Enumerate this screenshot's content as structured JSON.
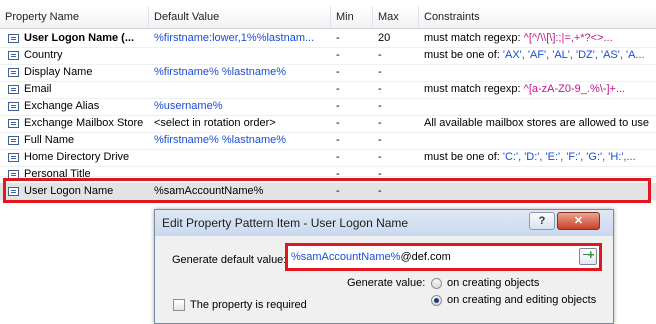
{
  "table": {
    "columns": [
      "Property Name",
      "Default Value",
      "Min",
      "Max",
      "Constraints"
    ],
    "rows": [
      {
        "name": "User Logon Name (...",
        "bold": true,
        "default": "%firstname:lower,1%%lastnam...",
        "min": "-",
        "max": "20",
        "constraints_prefix": "must match regexp: ",
        "constraints_value": "^[^/\\\\[\\]:;|=,+*?<>...",
        "value_blue": true
      },
      {
        "name": "Country",
        "bold": false,
        "default": "",
        "min": "-",
        "max": "-",
        "constraints_prefix": "must be one of: ",
        "constraints_value": "'AX', 'AF', 'AL', 'DZ', 'AS', 'A...",
        "value_blue": true
      },
      {
        "name": "Display Name",
        "bold": false,
        "default": "%firstname% %lastname%",
        "min": "-",
        "max": "-",
        "constraints_prefix": "",
        "constraints_value": "",
        "value_blue": true
      },
      {
        "name": "Email",
        "bold": false,
        "default": "",
        "min": "-",
        "max": "-",
        "constraints_prefix": "must match regexp: ",
        "constraints_value": "^[a-zA-Z0-9_.%\\-]+...",
        "value_blue": true
      },
      {
        "name": "Exchange Alias",
        "bold": false,
        "default": "%username%",
        "min": "-",
        "max": "-",
        "constraints_prefix": "",
        "constraints_value": "",
        "value_blue": true
      },
      {
        "name": "Exchange Mailbox Store",
        "bold": false,
        "default": "<select in rotation order>",
        "min": "-",
        "max": "-",
        "constraints_prefix": "All available mailbox stores are allowed to use",
        "constraints_value": "",
        "value_blue": false
      },
      {
        "name": "Full Name",
        "bold": false,
        "default": "%firstname% %lastname%",
        "min": "-",
        "max": "-",
        "constraints_prefix": "",
        "constraints_value": "",
        "value_blue": true
      },
      {
        "name": "Home Directory Drive",
        "bold": false,
        "default": "",
        "min": "-",
        "max": "-",
        "constraints_prefix": "must be one of: ",
        "constraints_value": "'C:', 'D:', 'E:', 'F:', 'G:', 'H:',...",
        "value_blue": true
      },
      {
        "name": "Personal Title",
        "bold": false,
        "default": "",
        "min": "-",
        "max": "-",
        "constraints_prefix": "",
        "constraints_value": "",
        "value_blue": true
      },
      {
        "name": "User Logon Name",
        "bold": false,
        "default": "%samAccountName%",
        "min": "-",
        "max": "-",
        "constraints_prefix": "",
        "constraints_value": "",
        "value_blue": false,
        "selected": true
      }
    ]
  },
  "dialog": {
    "title": "Edit Property Pattern Item - User Logon Name",
    "help_label": "?",
    "close_label": "✕",
    "generate_default_label": "Generate default value:",
    "input_blue_part": "%samAccountName%",
    "input_black_part": "@def.com",
    "generate_value_label": "Generate value:",
    "radio_creating_label": "on creating objects",
    "radio_editing_label": "on creating and editing objects",
    "radio_selected": "editing",
    "required_label": "The property is required",
    "required_checked": false
  },
  "colors": {
    "highlight_red": "#e2161f",
    "link_blue": "#1b4dd6",
    "regexp_magenta": "#c4138e"
  }
}
